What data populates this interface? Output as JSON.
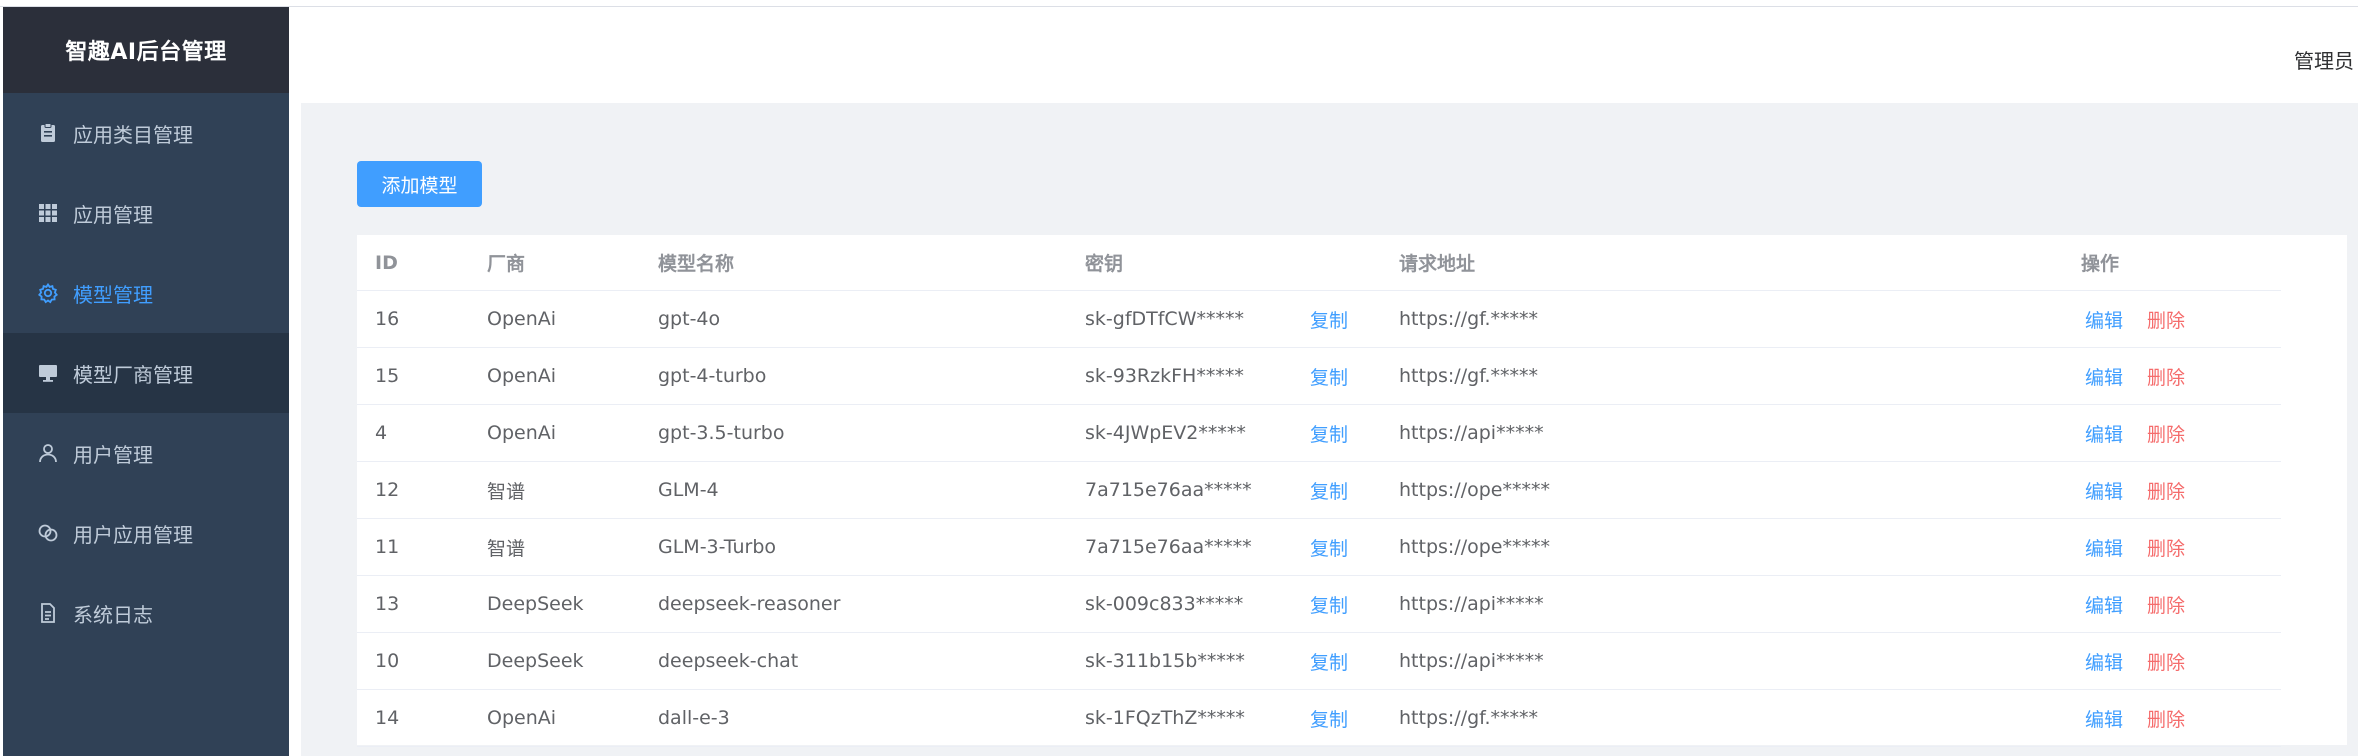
{
  "app": {
    "title": "智趣AI后台管理"
  },
  "header": {
    "user": "管理员"
  },
  "sidebar": {
    "items": [
      {
        "label": "应用类目管理",
        "icon": "clipboard-icon"
      },
      {
        "label": "应用管理",
        "icon": "grid-icon"
      },
      {
        "label": "模型管理",
        "icon": "gear-icon",
        "active": true
      },
      {
        "label": "模型厂商管理",
        "icon": "monitor-icon"
      },
      {
        "label": "用户管理",
        "icon": "user-icon"
      },
      {
        "label": "用户应用管理",
        "icon": "link-icon"
      },
      {
        "label": "系统日志",
        "icon": "document-icon"
      }
    ]
  },
  "toolbar": {
    "add_label": "添加模型"
  },
  "table": {
    "headers": {
      "id": "ID",
      "vendor": "厂商",
      "name": "模型名称",
      "key": "密钥",
      "copy": "",
      "url": "请求地址",
      "ops": "操作"
    },
    "copy_label": "复制",
    "edit_label": "编辑",
    "delete_label": "删除",
    "rows": [
      {
        "id": "16",
        "vendor": "OpenAi",
        "name": "gpt-4o",
        "key": "sk-gfDTfCW*****",
        "url": "https://gf.*****"
      },
      {
        "id": "15",
        "vendor": "OpenAi",
        "name": "gpt-4-turbo",
        "key": "sk-93RzkFH*****",
        "url": "https://gf.*****"
      },
      {
        "id": "4",
        "vendor": "OpenAi",
        "name": "gpt-3.5-turbo",
        "key": "sk-4JWpEV2*****",
        "url": "https://api*****"
      },
      {
        "id": "12",
        "vendor": "智谱",
        "name": "GLM-4",
        "key": "7a715e76aa*****",
        "url": "https://ope*****"
      },
      {
        "id": "11",
        "vendor": "智谱",
        "name": "GLM-3-Turbo",
        "key": "7a715e76aa*****",
        "url": "https://ope*****"
      },
      {
        "id": "13",
        "vendor": "DeepSeek",
        "name": "deepseek-reasoner",
        "key": "sk-009c833*****",
        "url": "https://api*****"
      },
      {
        "id": "10",
        "vendor": "DeepSeek",
        "name": "deepseek-chat",
        "key": "sk-311b15b*****",
        "url": "https://api*****"
      },
      {
        "id": "14",
        "vendor": "OpenAi",
        "name": "dall-e-3",
        "key": "sk-1FQzThZ*****",
        "url": "https://gf.*****"
      }
    ]
  },
  "colors": {
    "sidebar": "#304156",
    "brand": "#2b2f3a",
    "accent": "#409eff",
    "danger": "#f56c6c"
  }
}
